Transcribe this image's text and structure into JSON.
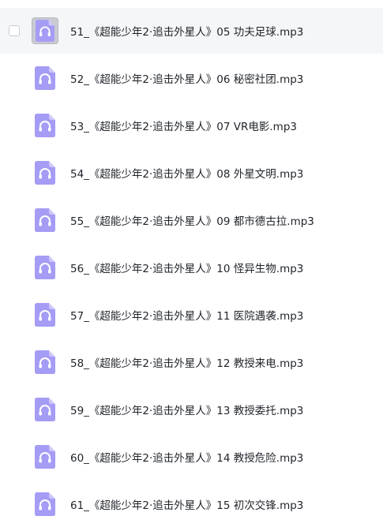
{
  "file_list": {
    "accent_color": "#a59cf5",
    "icon": "audio-file-icon",
    "items": [
      {
        "name": "51_《超能少年2·追击外星人》05 功夫足球.mp3",
        "hovered": true
      },
      {
        "name": "52_《超能少年2·追击外星人》06 秘密社团.mp3",
        "hovered": false
      },
      {
        "name": "53_《超能少年2·追击外星人》07 VR电影.mp3",
        "hovered": false
      },
      {
        "name": "54_《超能少年2·追击外星人》08 外星文明.mp3",
        "hovered": false
      },
      {
        "name": "55_《超能少年2·追击外星人》09 都市德古拉.mp3",
        "hovered": false
      },
      {
        "name": "56_《超能少年2·追击外星人》10 怪异生物.mp3",
        "hovered": false
      },
      {
        "name": "57_《超能少年2·追击外星人》11 医院遇袭.mp3",
        "hovered": false
      },
      {
        "name": "58_《超能少年2·追击外星人》12 教授来电.mp3",
        "hovered": false
      },
      {
        "name": "59_《超能少年2·追击外星人》13 教授委托.mp3",
        "hovered": false
      },
      {
        "name": "60_《超能少年2·追击外星人》14 教授危险.mp3",
        "hovered": false
      },
      {
        "name": "61_《超能少年2·追击外星人》15 初次交锋.mp3",
        "hovered": false
      }
    ]
  }
}
